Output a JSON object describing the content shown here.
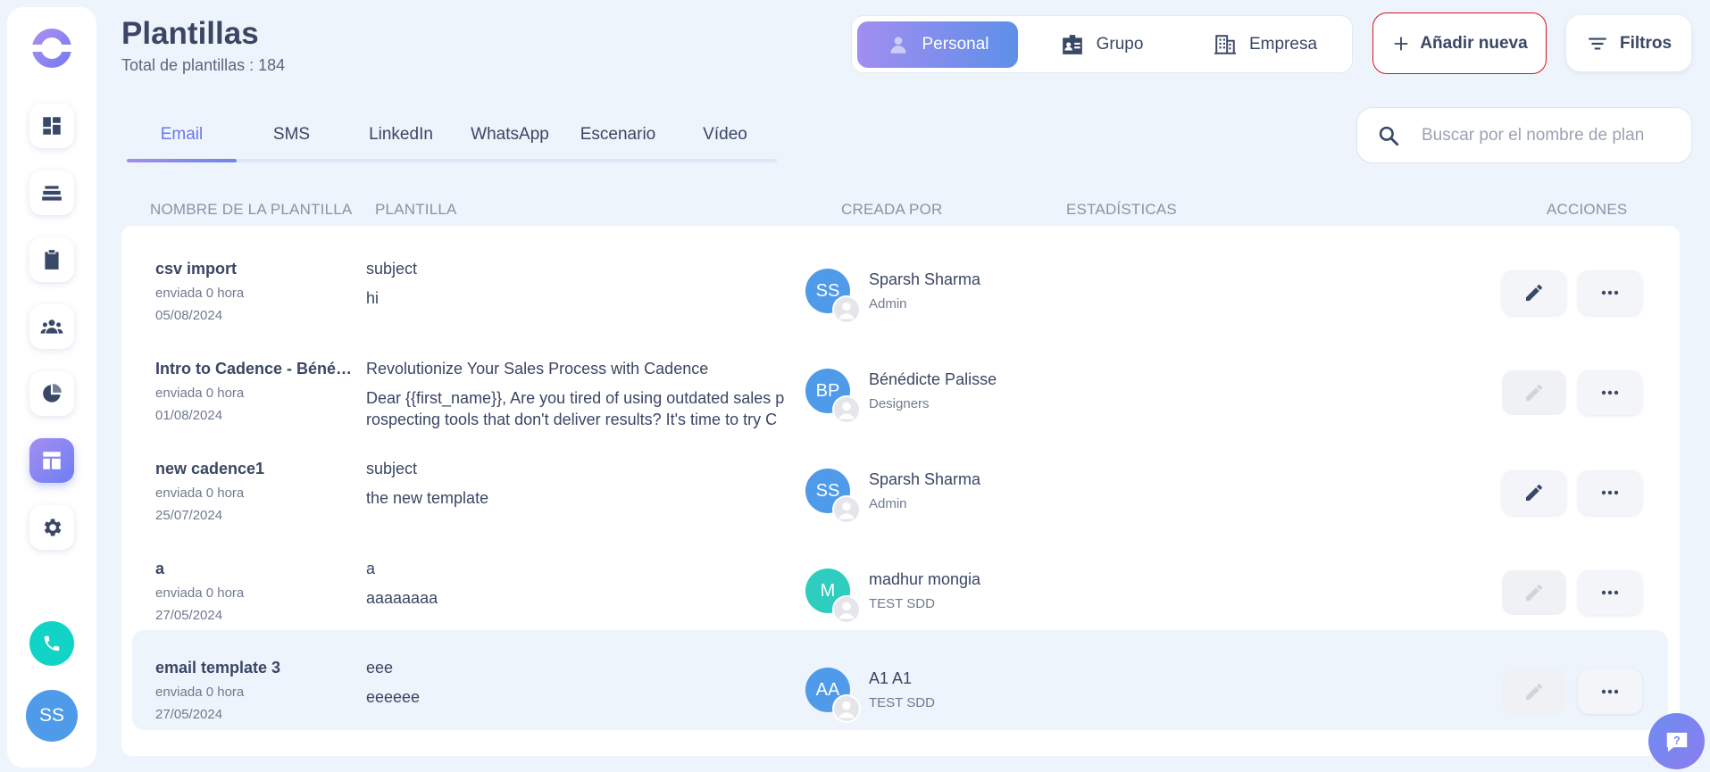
{
  "header": {
    "title": "Plantillas",
    "subtitle": "Total de plantillas : 184"
  },
  "scope_toggle": {
    "options": [
      {
        "label": "Personal",
        "icon": "person-icon",
        "active": true
      },
      {
        "label": "Grupo",
        "icon": "id-card-icon",
        "active": false
      },
      {
        "label": "Empresa",
        "icon": "building-icon",
        "active": false
      }
    ]
  },
  "toolbar": {
    "add_label": "Añadir nueva",
    "filters_label": "Filtros"
  },
  "tabs": [
    {
      "label": "Email",
      "active": true
    },
    {
      "label": "SMS",
      "active": false
    },
    {
      "label": "LinkedIn",
      "active": false
    },
    {
      "label": "WhatsApp",
      "active": false
    },
    {
      "label": "Escenario",
      "active": false
    },
    {
      "label": "Vídeo",
      "active": false
    }
  ],
  "search": {
    "placeholder": "Buscar por el nombre de plan",
    "value": ""
  },
  "table": {
    "columns": [
      "NOMBRE DE LA PLANTILLA",
      "PLANTILLA",
      "CREADA POR",
      "ESTADÍSTICAS",
      "ACCIONES"
    ],
    "rows": [
      {
        "name": "csv import",
        "sent": "enviada 0 hora",
        "date": "05/08/2024",
        "subject": "subject",
        "body": "hi",
        "initials": "SS",
        "avatar_color": "#4f9be9",
        "creator": "Sparsh Sharma",
        "role": "Admin",
        "edit_enabled": true,
        "highlighted": false
      },
      {
        "name": "Intro to Cadence - Bénédicte Palisse",
        "sent": "enviada 0 hora",
        "date": "01/08/2024",
        "subject": "Revolutionize Your Sales Process with Cadence",
        "body": "Dear {{first_name}},   Are you tired of using outdated sales prospecting tools that don't deliver results? It's time to try Cadence",
        "initials": "BP",
        "avatar_color": "#4f9be9",
        "creator": "Bénédicte Palisse",
        "role": "Designers",
        "edit_enabled": false,
        "highlighted": false
      },
      {
        "name": "new cadence1",
        "sent": "enviada 0 hora",
        "date": "25/07/2024",
        "subject": "subject",
        "body": "the new template",
        "initials": "SS",
        "avatar_color": "#4f9be9",
        "creator": "Sparsh Sharma",
        "role": "Admin",
        "edit_enabled": true,
        "highlighted": false
      },
      {
        "name": "a",
        "sent": "enviada 0 hora",
        "date": "27/05/2024",
        "subject": "a",
        "body": "aaaaaaaa",
        "initials": "M",
        "avatar_color": "#2fcdbf",
        "creator": "madhur mongia",
        "role": "TEST SDD",
        "edit_enabled": false,
        "highlighted": false
      },
      {
        "name": "email template 3",
        "sent": "enviada 0 hora",
        "date": "27/05/2024",
        "subject": "eee",
        "body": "eeeeee",
        "initials": "AA",
        "avatar_color": "#4f9be9",
        "creator": "A1 A1",
        "role": "TEST SDD",
        "edit_enabled": false,
        "highlighted": true
      }
    ]
  },
  "user": {
    "initials": "SS"
  },
  "sidebar": {
    "icons": [
      "dashboard-icon",
      "cadences-icon",
      "tasks-icon",
      "people-icon",
      "analytics-icon",
      "templates-icon",
      "settings-icon"
    ],
    "active": "templates-icon"
  },
  "colors": {
    "accent": "#6a78e8",
    "add_border": "#d8131f",
    "phone": "#12d4c6"
  }
}
